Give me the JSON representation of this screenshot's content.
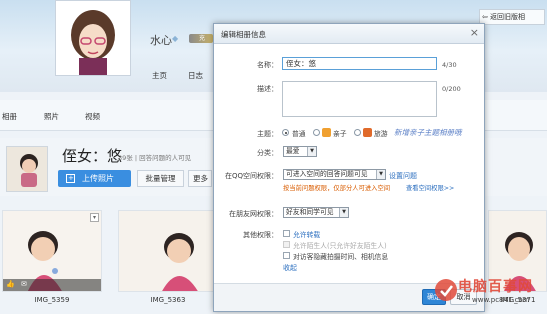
{
  "profile": {
    "nickname": "水心",
    "vip_label": "充"
  },
  "top_nav": [
    "主页",
    "日志"
  ],
  "sub_nav": {
    "items": [
      "相册",
      "照片",
      "视频"
    ],
    "restore_label": "返回旧版相"
  },
  "album": {
    "title": "侄女：悠",
    "photo_count": "39张 | 回答问题的人可见",
    "upload_label": "上传照片",
    "batch_label": "批量管理",
    "more_label": "更多"
  },
  "photos": [
    {
      "caption": "IMG_5359"
    },
    {
      "caption": "IMG_5363"
    },
    {
      "caption": ""
    },
    {
      "caption": ""
    },
    {
      "caption": "IMG_5371"
    }
  ],
  "dialog": {
    "title": "编辑相册信息",
    "name_label": "名称：",
    "name_value": "侄女：悠",
    "name_counter": "4/30",
    "desc_label": "描述：",
    "desc_counter": "0/200",
    "theme_label": "主题：",
    "theme_options": [
      "普通",
      "亲子",
      "旅游"
    ],
    "theme_selected": "普通",
    "theme_link": "新增亲子主题相册哦",
    "category_label": "分类：",
    "category_value": "最爱",
    "qq_perm_label": "在QQ空间权限：",
    "qq_perm_value": "可进入空间的回答问题可见",
    "qq_perm_link": "设置问题",
    "qq_perm_warning": "按当前问题权限，仅部分人可进入空间",
    "qq_perm_warning_link": "查看空间权限>>",
    "friend_perm_label": "在朋友网权限：",
    "friend_perm_value": "好友和同学可见",
    "other_perm_label": "其他权限：",
    "allow_repost": "允许转载",
    "allow_stranger": "允许陌生人(只允许好友陌生人)",
    "hide_info": "对访客隐藏拍摄时间、相机信息",
    "collapse_link": "收起",
    "ok_label": "确定",
    "cancel_label": "取消"
  },
  "watermark": {
    "text": "电脑百事网",
    "url": "www.pc841.com"
  },
  "colors": {
    "accent": "#3a8ee0",
    "link": "#2a6ebf",
    "warning": "#d95c00"
  }
}
